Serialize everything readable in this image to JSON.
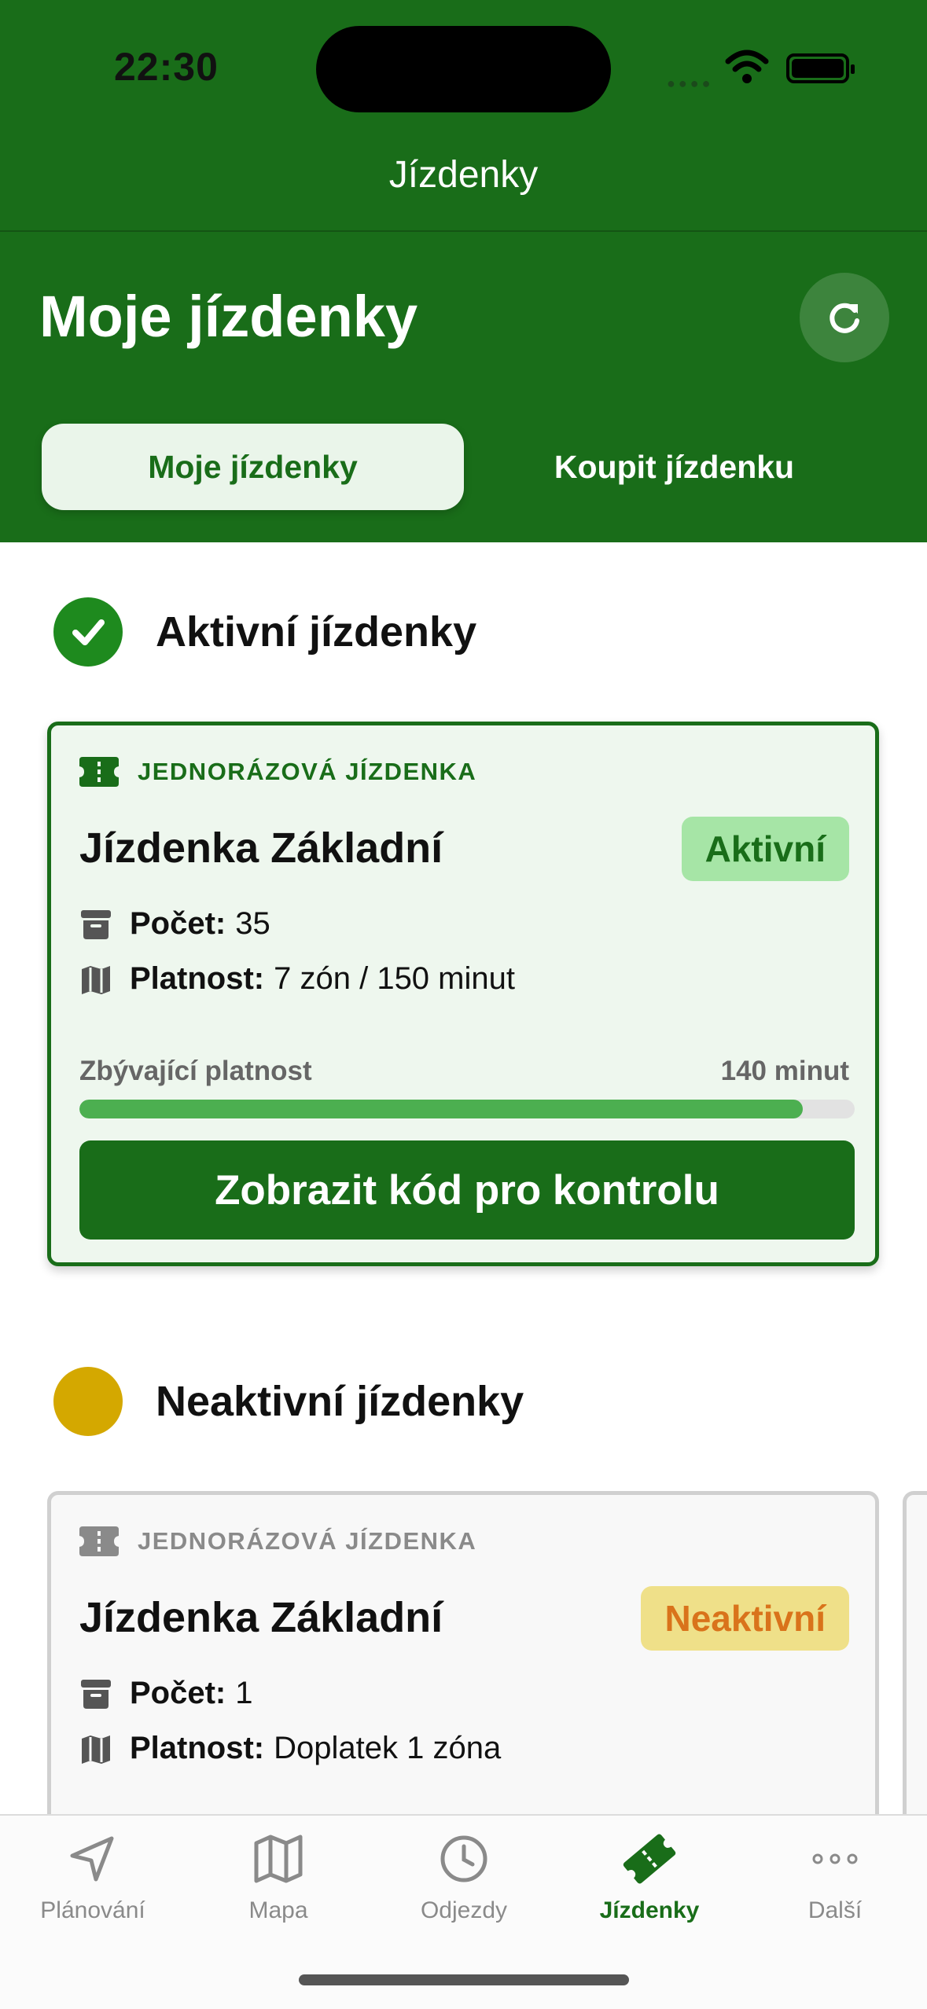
{
  "status_bar": {
    "time": "22:30"
  },
  "nav": {
    "title": "Jízdenky"
  },
  "header": {
    "title": "Moje jízdenky"
  },
  "segments": [
    {
      "label": "Moje jízdenky",
      "selected": true
    },
    {
      "label": "Koupit jízdenku",
      "selected": false
    }
  ],
  "active_section": {
    "title": "Aktivní jízdenky",
    "icon": "check-circle-icon",
    "icon_color": "#1e8a1e"
  },
  "active_ticket": {
    "type": "JEDNORÁZOVÁ JÍZDENKA",
    "name": "Jízdenka Základní",
    "status": "Aktivní",
    "count_label": "Počet:",
    "count_value": "35",
    "validity_label": "Platnost:",
    "validity_value": "7 zón / 150 minut",
    "remaining_label": "Zbývající platnost",
    "remaining_value": "140 minut",
    "remaining_fraction": 0.933,
    "button_label": "Zobrazit kód pro kontrolu"
  },
  "inactive_section": {
    "title": "Neaktivní jízdenky",
    "icon": "pending-circle-icon",
    "icon_color": "#d4a800"
  },
  "inactive_ticket": {
    "type": "JEDNORÁZOVÁ JÍZDENKA",
    "name": "Jízdenka Základní",
    "status": "Neaktivní",
    "count_label": "Počet:",
    "count_value": "1",
    "validity_label": "Platnost:",
    "validity_value": "Doplatek 1 zóna"
  },
  "tabbar": [
    {
      "label": "Plánování",
      "icon": "navigation-arrow-icon",
      "active": false
    },
    {
      "label": "Mapa",
      "icon": "map-icon",
      "active": false
    },
    {
      "label": "Odjezdy",
      "icon": "clock-icon",
      "active": false
    },
    {
      "label": "Jízdenky",
      "icon": "ticket-icon",
      "active": true
    },
    {
      "label": "Další",
      "icon": "more-dots-icon",
      "active": false
    }
  ],
  "colors": {
    "brand_green": "#196d19",
    "progress_green": "#4caf50",
    "inactive_badge_bg": "#efe089",
    "inactive_badge_text": "#d9731b"
  }
}
